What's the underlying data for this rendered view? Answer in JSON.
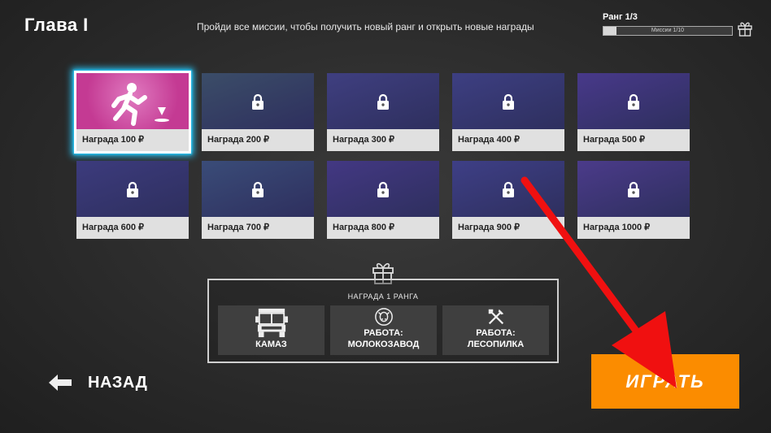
{
  "header": {
    "title": "Глава I",
    "subtitle": "Пройди все миссии, чтобы получить новый ранг и открыть новые награды",
    "rank_label": "Ранг 1/3",
    "progress_text": "Миссии 1/10",
    "progress_fraction": 0.1
  },
  "missions": [
    {
      "label": "Награда 100 ₽",
      "locked": false,
      "bg": "#c43a93"
    },
    {
      "label": "Награда 200 ₽",
      "locked": true,
      "bg": "#3b4d68"
    },
    {
      "label": "Награда 300 ₽",
      "locked": true,
      "bg": "#3f3f80"
    },
    {
      "label": "Награда 400 ₽",
      "locked": true,
      "bg": "#3d3f82"
    },
    {
      "label": "Награда 500 ₽",
      "locked": true,
      "bg": "#48398a"
    },
    {
      "label": "Награда 600 ₽",
      "locked": true,
      "bg": "#3c3b7d"
    },
    {
      "label": "Награда 700 ₽",
      "locked": true,
      "bg": "#3a4c78"
    },
    {
      "label": "Награда 800 ₽",
      "locked": true,
      "bg": "#433883"
    },
    {
      "label": "Награда 900 ₽",
      "locked": true,
      "bg": "#3e3f86"
    },
    {
      "label": "Награда 1000 ₽",
      "locked": true,
      "bg": "#4b3b8a"
    }
  ],
  "rank_reward": {
    "title": "НАГРАДА 1 РАНГА",
    "items": [
      {
        "label": "КАМАЗ",
        "icon": "truck-icon"
      },
      {
        "label": "РАБОТА:\nМОЛОКОЗАВОД",
        "icon": "cow-icon"
      },
      {
        "label": "РАБОТА:\nЛЕСОПИЛКА",
        "icon": "tools-icon"
      }
    ]
  },
  "buttons": {
    "back": "НАЗАД",
    "play": "ИГРАТЬ"
  },
  "colors": {
    "accent": "#fb8c00",
    "selection_glow": "#27c4f5",
    "arrow": "#f01010"
  }
}
